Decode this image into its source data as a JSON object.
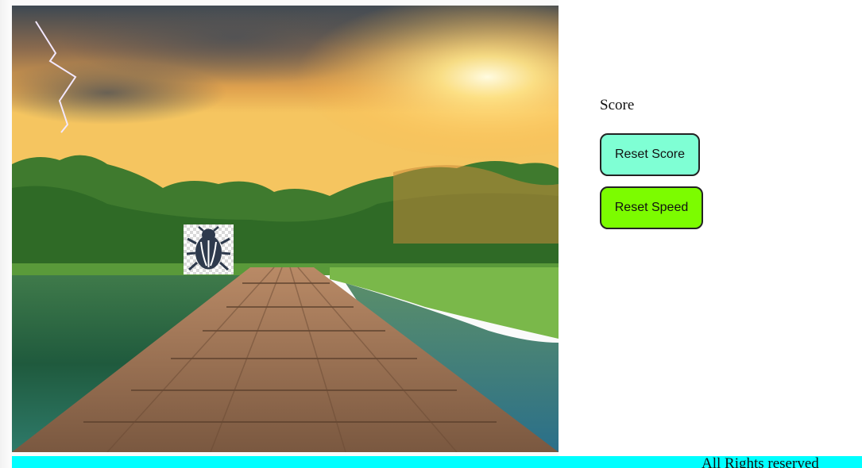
{
  "score": {
    "label": "Score"
  },
  "buttons": {
    "reset_score": "Reset Score",
    "reset_speed": "Reset Speed"
  },
  "footer": {
    "text": "All Rights reserved"
  },
  "game": {
    "target_icon": "beetle-icon",
    "background": "wooden bridge over lake at sunset"
  },
  "colors": {
    "reset_score_bg": "#7fffd4",
    "reset_speed_bg": "#7cfc00",
    "footer_bg": "#00ffff",
    "bug_color": "#2e3a4d"
  }
}
